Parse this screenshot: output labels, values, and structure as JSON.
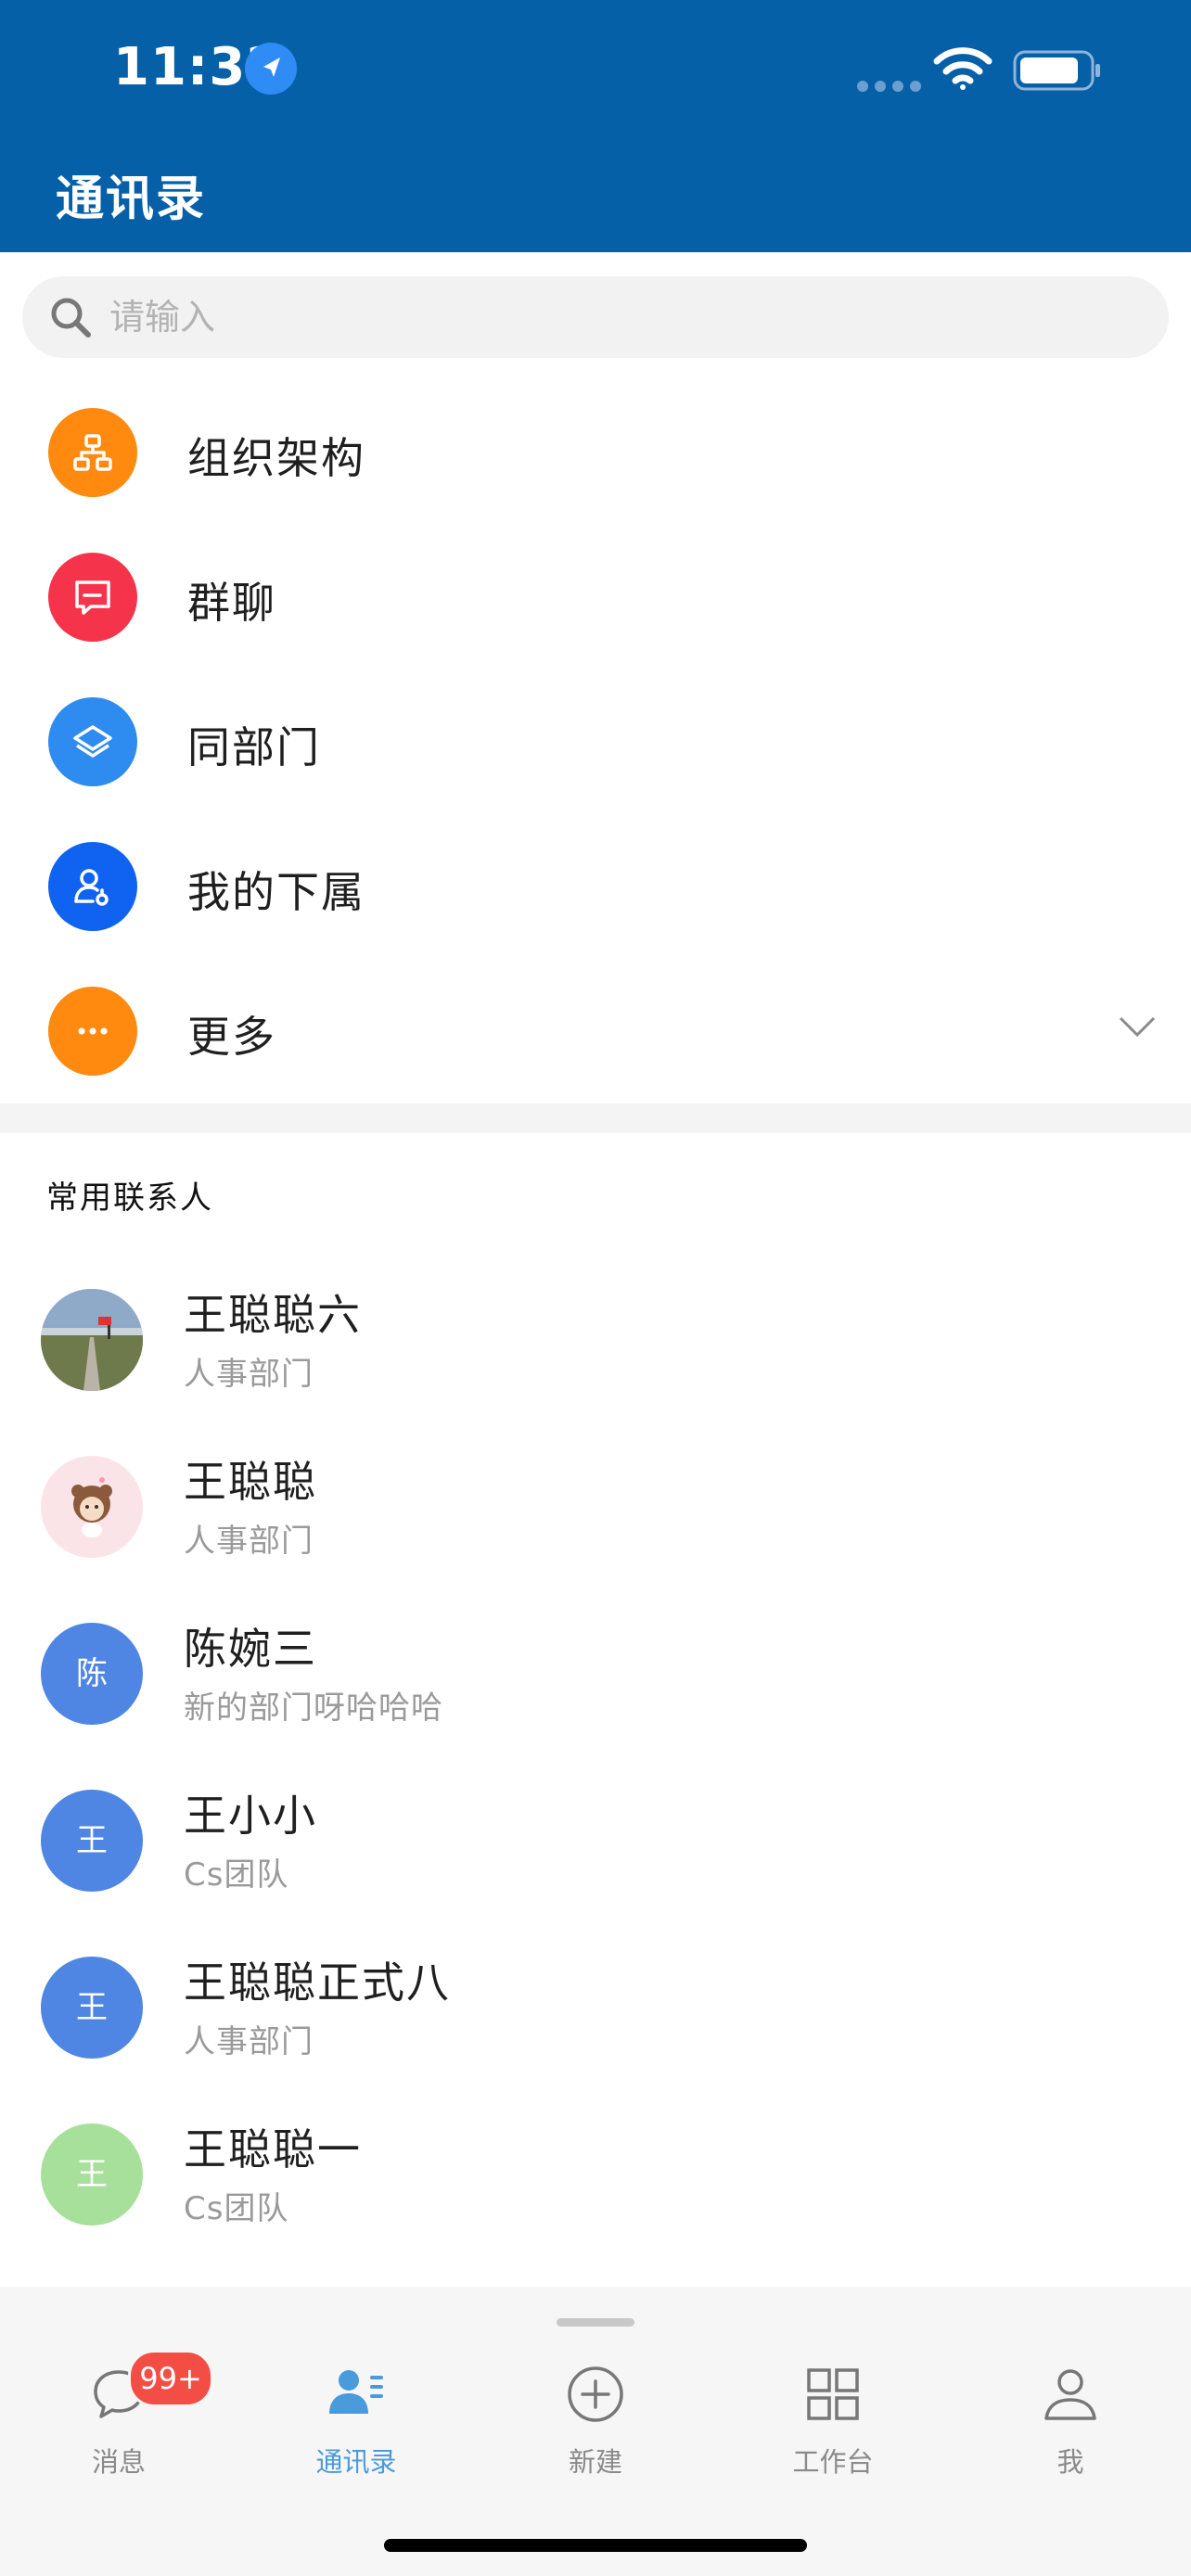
{
  "status_bar": {
    "time": "11:32"
  },
  "header": {
    "title": "通讯录"
  },
  "search": {
    "placeholder": "请输入"
  },
  "menu": [
    {
      "label": "组织架构",
      "icon": "org-chart-icon",
      "color": "#ff8a0f"
    },
    {
      "label": "群聊",
      "icon": "chat-bubble-icon",
      "color": "#f5334a"
    },
    {
      "label": "同部门",
      "icon": "layers-icon",
      "color": "#2e8bef"
    },
    {
      "label": "我的下属",
      "icon": "subordinate-icon",
      "color": "#0f63f0"
    },
    {
      "label": "更多",
      "icon": "more-dots-icon",
      "color": "#ff8a0f"
    }
  ],
  "frequent_contacts": {
    "title": "常用联系人",
    "items": [
      {
        "name": "王聪聪六",
        "dept": "人事部门",
        "avatar": "photo"
      },
      {
        "name": "王聪聪",
        "dept": "人事部门",
        "avatar": "cartoon"
      },
      {
        "name": "陈婉三",
        "dept": "新的部门呀哈哈哈",
        "avatar_text": "陈",
        "avatar_color": "#4f86e3"
      },
      {
        "name": "王小小",
        "dept": "Cs团队",
        "avatar_text": "王",
        "avatar_color": "#4f86e3"
      },
      {
        "name": "王聪聪正式八",
        "dept": "人事部门",
        "avatar_text": "王",
        "avatar_color": "#4f86e3"
      },
      {
        "name": "王聪聪一",
        "dept": "Cs团队",
        "avatar_text": "王",
        "avatar_color": "#a6e09a"
      }
    ]
  },
  "tabbar": {
    "badge": "99+",
    "tabs": [
      {
        "label": "消息",
        "icon": "message-icon"
      },
      {
        "label": "通讯录",
        "icon": "contacts-icon",
        "active": true
      },
      {
        "label": "新建",
        "icon": "plus-circle-icon"
      },
      {
        "label": "工作台",
        "icon": "grid-icon"
      },
      {
        "label": "我",
        "icon": "person-icon"
      }
    ]
  }
}
